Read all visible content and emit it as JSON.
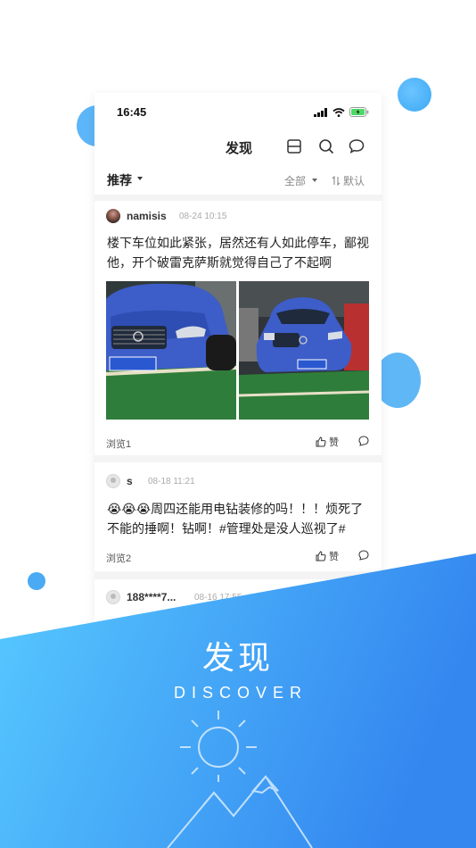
{
  "status_bar": {
    "time": "16:45"
  },
  "nav": {
    "title": "发现"
  },
  "filter": {
    "tab": "推荐",
    "scope": "全部",
    "sort": "默认"
  },
  "posts": [
    {
      "username": "namisis",
      "time": "08-24 10:15",
      "text": "楼下车位如此紧张，居然还有人如此停车，鄙视他，开个破雷克萨斯就觉得自己了不起啊",
      "plates": [
        "粤BN15V6",
        "粤BN15V6"
      ],
      "views": "浏览1",
      "like": "赞"
    },
    {
      "username": "s",
      "time": "08-18 11:21",
      "text": "😭😭😭周四还能用电钻装修的吗！！！烦死了 不能的捶啊！钻啊！#管理处是没人巡视了#",
      "views": "浏览2",
      "like": "赞"
    },
    {
      "username": "188****7...",
      "time": "08-16 17:55"
    }
  ],
  "banner": {
    "title": "发现",
    "subtitle": "DISCOVER"
  },
  "colors": {
    "brand_blue": "#3a8ff0",
    "light_blue": "#55c6ff",
    "bubble": "#5db6f7"
  },
  "icons": [
    "signal-icon",
    "wifi-icon",
    "battery-icon",
    "scan-icon",
    "search-icon",
    "message-icon",
    "sort-icon",
    "thumb-up-icon",
    "comment-icon",
    "sun-icon",
    "mountain-icon"
  ]
}
